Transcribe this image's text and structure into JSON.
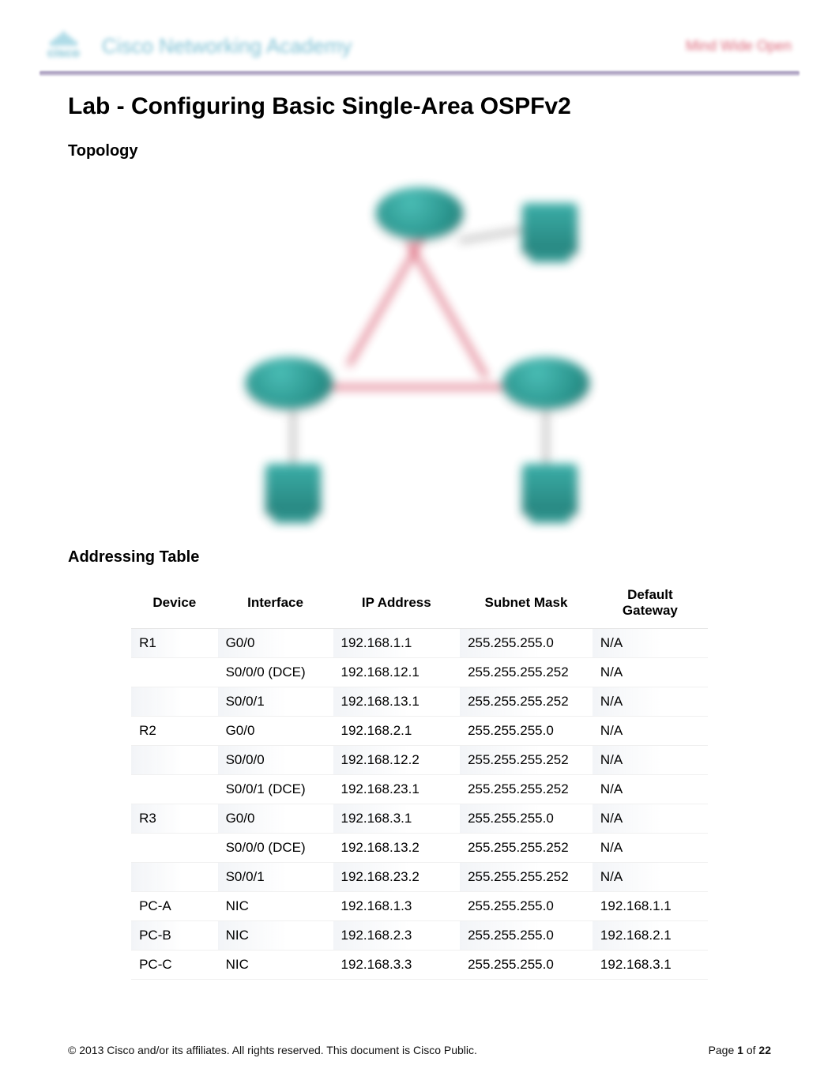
{
  "header": {
    "logo_text": "cisco",
    "brand": "Cisco Networking Academy",
    "right": "Mind Wide Open"
  },
  "title": "Lab - Configuring Basic Single-Area OSPFv2",
  "sections": {
    "topology": "Topology",
    "addressing": "Addressing Table"
  },
  "table": {
    "headers": {
      "device": "Device",
      "interface": "Interface",
      "ip": "IP Address",
      "mask": "Subnet Mask",
      "gw": "Default Gateway"
    },
    "rows": [
      {
        "device": "R1",
        "interface": "G0/0",
        "ip": "192.168.1.1",
        "mask": "255.255.255.0",
        "gw": "N/A"
      },
      {
        "device": "",
        "interface": "S0/0/0 (DCE)",
        "ip": "192.168.12.1",
        "mask": "255.255.255.252",
        "gw": "N/A"
      },
      {
        "device": "",
        "interface": "S0/0/1",
        "ip": "192.168.13.1",
        "mask": "255.255.255.252",
        "gw": "N/A"
      },
      {
        "device": "R2",
        "interface": "G0/0",
        "ip": "192.168.2.1",
        "mask": "255.255.255.0",
        "gw": "N/A"
      },
      {
        "device": "",
        "interface": "S0/0/0",
        "ip": "192.168.12.2",
        "mask": "255.255.255.252",
        "gw": "N/A"
      },
      {
        "device": "",
        "interface": "S0/0/1 (DCE)",
        "ip": "192.168.23.1",
        "mask": "255.255.255.252",
        "gw": "N/A"
      },
      {
        "device": "R3",
        "interface": "G0/0",
        "ip": "192.168.3.1",
        "mask": "255.255.255.0",
        "gw": "N/A"
      },
      {
        "device": "",
        "interface": "S0/0/0 (DCE)",
        "ip": "192.168.13.2",
        "mask": "255.255.255.252",
        "gw": "N/A"
      },
      {
        "device": "",
        "interface": "S0/0/1",
        "ip": "192.168.23.2",
        "mask": "255.255.255.252",
        "gw": "N/A"
      },
      {
        "device": "PC-A",
        "interface": "NIC",
        "ip": "192.168.1.3",
        "mask": "255.255.255.0",
        "gw": "192.168.1.1"
      },
      {
        "device": "PC-B",
        "interface": "NIC",
        "ip": "192.168.2.3",
        "mask": "255.255.255.0",
        "gw": "192.168.2.1"
      },
      {
        "device": "PC-C",
        "interface": "NIC",
        "ip": "192.168.3.3",
        "mask": "255.255.255.0",
        "gw": "192.168.3.1"
      }
    ]
  },
  "footer": {
    "copyright": "© 2013 Cisco and/or its affiliates. All rights reserved. This document is Cisco Public.",
    "page_prefix": "Page ",
    "page_current": "1",
    "page_sep": " of ",
    "page_total": "22"
  }
}
